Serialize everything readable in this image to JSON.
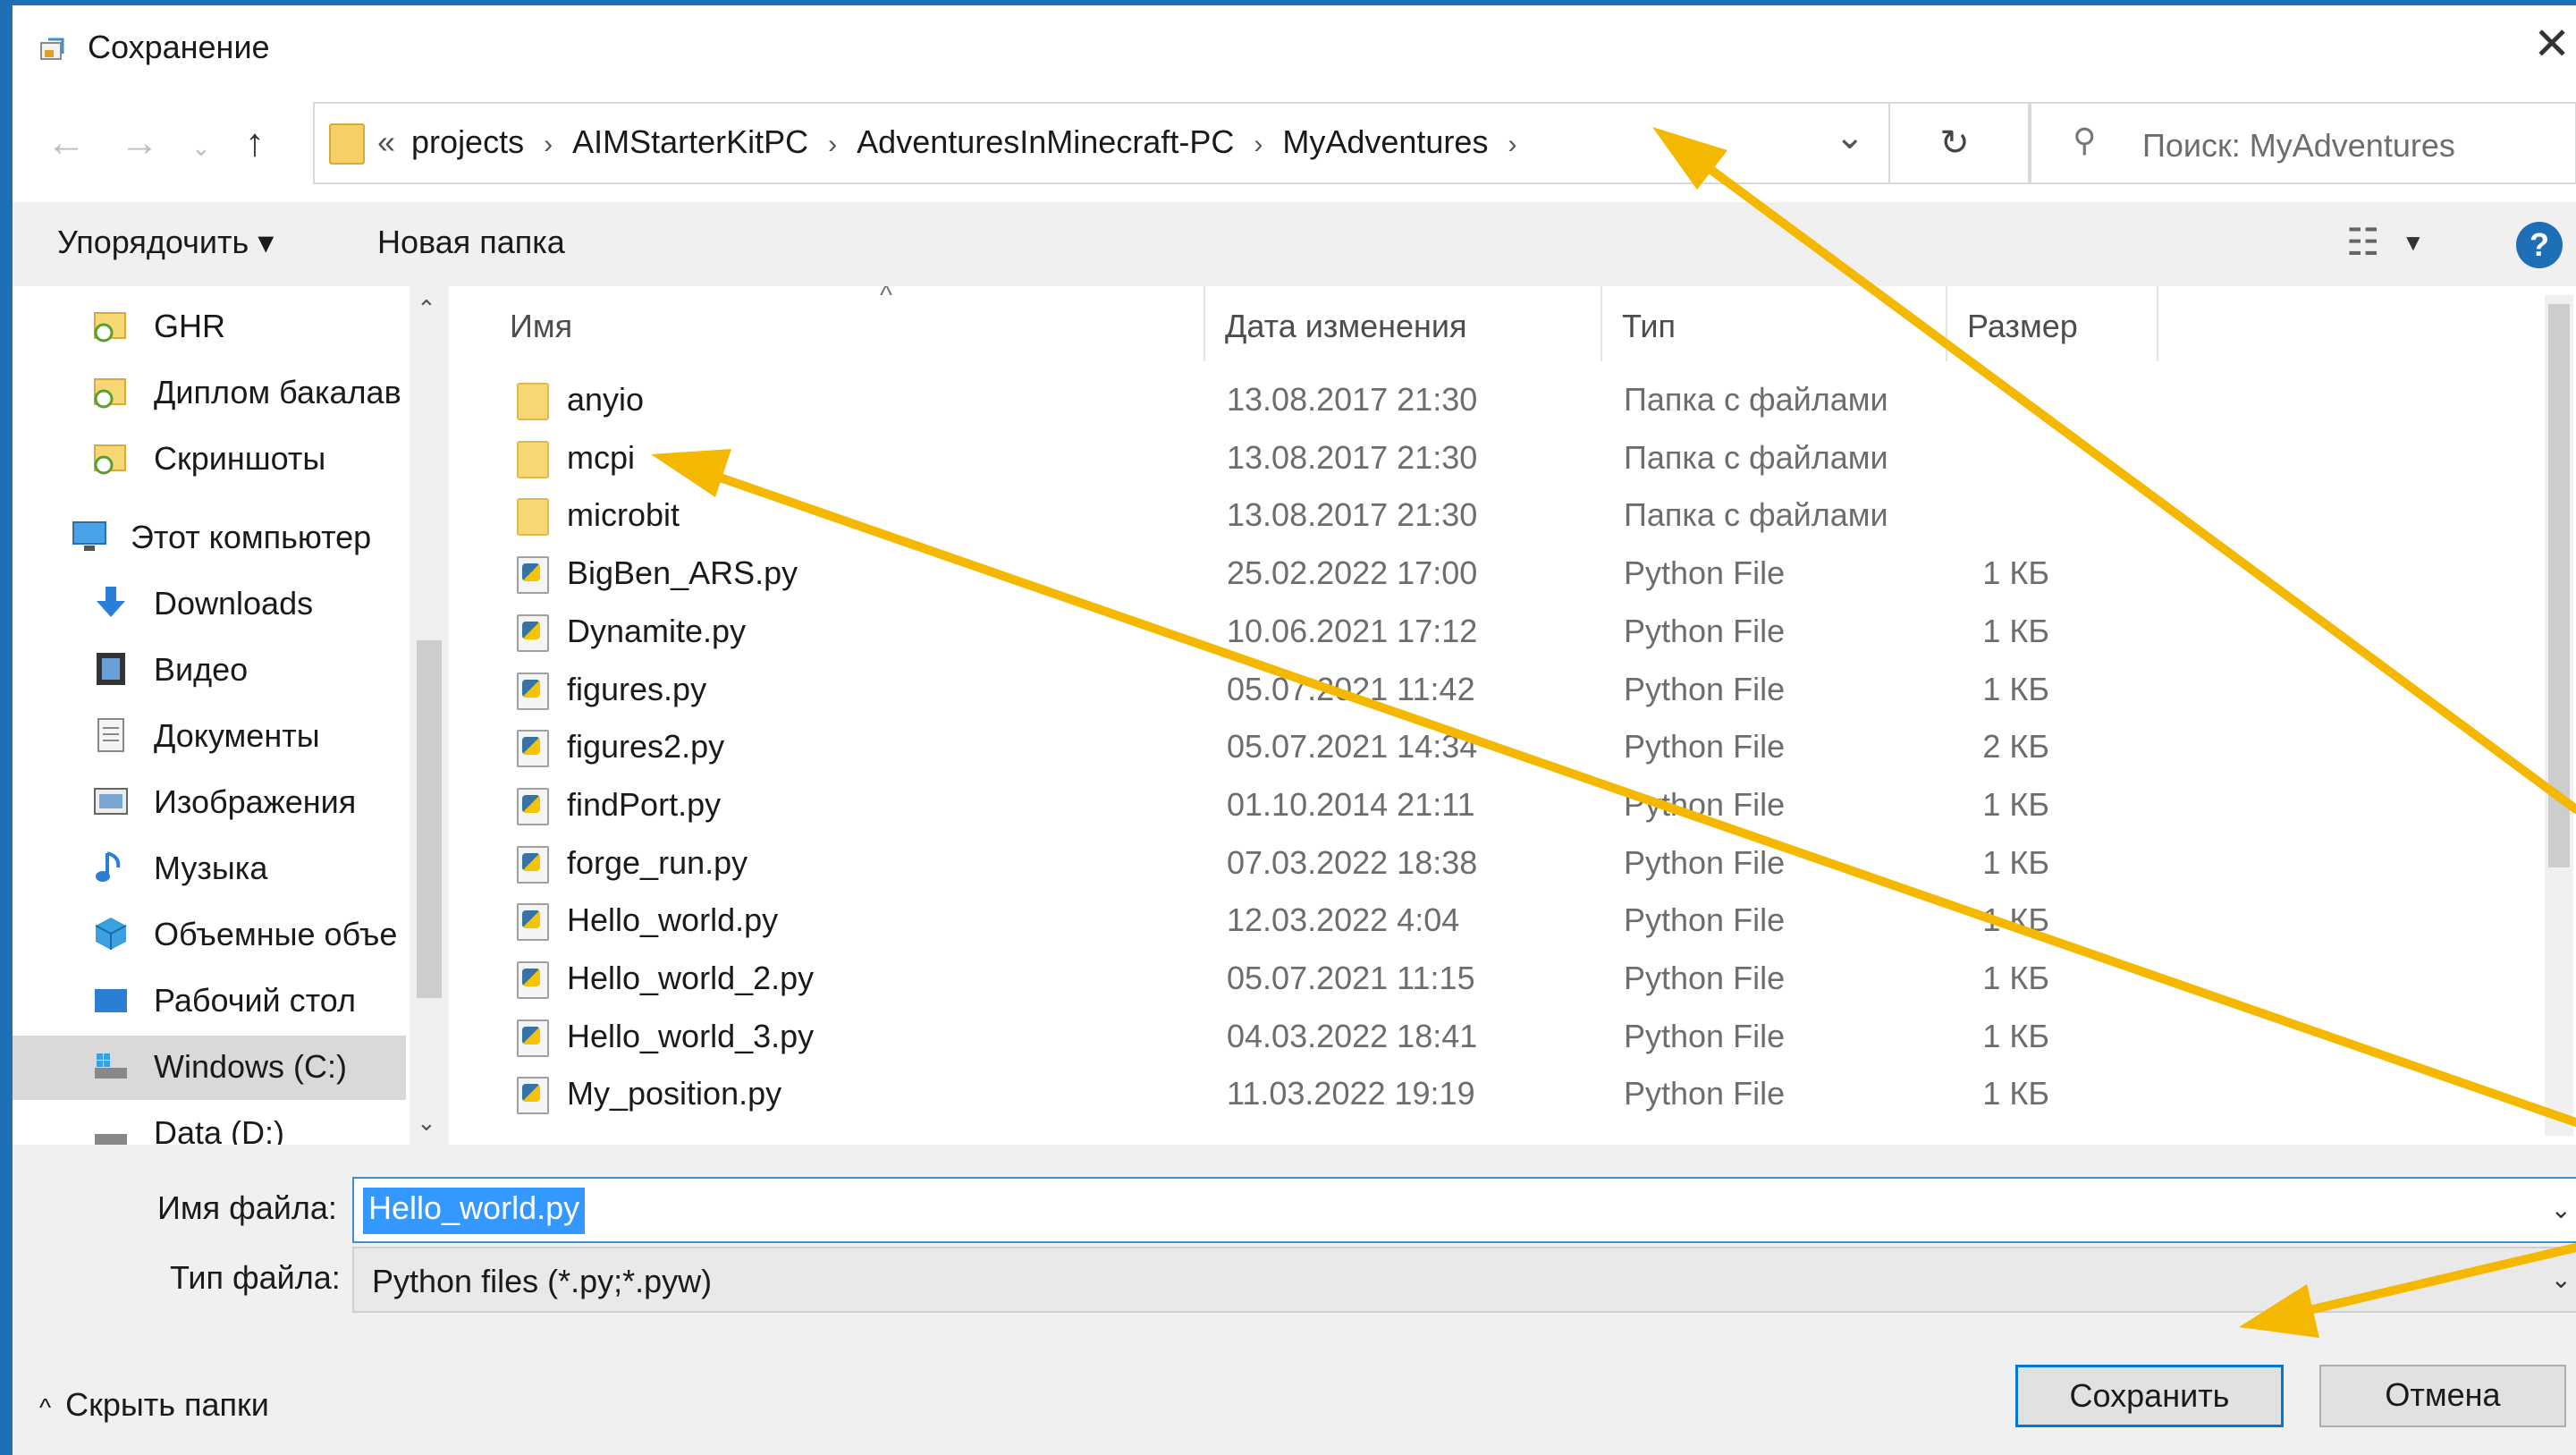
{
  "window": {
    "title": "Сохранение"
  },
  "address": {
    "overflow": "«",
    "crumbs": [
      "projects",
      "AIMStarterKitPC",
      "AdventuresInMinecraft-PC",
      "MyAdventures"
    ],
    "search_placeholder": "Поиск: MyAdventures"
  },
  "toolbar": {
    "organize": "Упорядочить ▾",
    "new_folder": "Новая папка",
    "help": "?"
  },
  "nav": {
    "items": [
      {
        "label": "GHR",
        "icon": "folder-sync-icon"
      },
      {
        "label": "Диплом бакалав",
        "icon": "folder-sync-icon"
      },
      {
        "label": "Скриншоты",
        "icon": "folder-sync-icon"
      },
      {
        "label": "Этот компьютер",
        "icon": "computer-icon"
      },
      {
        "label": "Downloads",
        "icon": "download-icon"
      },
      {
        "label": "Видео",
        "icon": "video-icon"
      },
      {
        "label": "Документы",
        "icon": "documents-icon"
      },
      {
        "label": "Изображения",
        "icon": "pictures-icon"
      },
      {
        "label": "Музыка",
        "icon": "music-icon"
      },
      {
        "label": "Объемные объе",
        "icon": "3d-objects-icon"
      },
      {
        "label": "Рабочий стол",
        "icon": "desktop-icon"
      },
      {
        "label": "Windows (C:)",
        "icon": "drive-icon"
      },
      {
        "label": "Data (D:)",
        "icon": "drive-icon"
      }
    ]
  },
  "columns": {
    "name": "Имя",
    "date": "Дата изменения",
    "type": "Тип",
    "size": "Размер"
  },
  "files": [
    {
      "name": "anyio",
      "date": "13.08.2017 21:30",
      "type": "Папка с файлами",
      "size": "",
      "kind": "folder"
    },
    {
      "name": "mcpi",
      "date": "13.08.2017 21:30",
      "type": "Папка с файлами",
      "size": "",
      "kind": "folder"
    },
    {
      "name": "microbit",
      "date": "13.08.2017 21:30",
      "type": "Папка с файлами",
      "size": "",
      "kind": "folder"
    },
    {
      "name": "BigBen_ARS.py",
      "date": "25.02.2022 17:00",
      "type": "Python File",
      "size": "1 КБ",
      "kind": "py"
    },
    {
      "name": "Dynamite.py",
      "date": "10.06.2021 17:12",
      "type": "Python File",
      "size": "1 КБ",
      "kind": "py"
    },
    {
      "name": "figures.py",
      "date": "05.07.2021 11:42",
      "type": "Python File",
      "size": "1 КБ",
      "kind": "py"
    },
    {
      "name": "figures2.py",
      "date": "05.07.2021 14:34",
      "type": "Python File",
      "size": "2 КБ",
      "kind": "py"
    },
    {
      "name": "findPort.py",
      "date": "01.10.2014 21:11",
      "type": "Python File",
      "size": "1 КБ",
      "kind": "py"
    },
    {
      "name": "forge_run.py",
      "date": "07.03.2022 18:38",
      "type": "Python File",
      "size": "1 КБ",
      "kind": "py"
    },
    {
      "name": "Hello_world.py",
      "date": "12.03.2022 4:04",
      "type": "Python File",
      "size": "1 КБ",
      "kind": "py"
    },
    {
      "name": "Hello_world_2.py",
      "date": "05.07.2021 11:15",
      "type": "Python File",
      "size": "1 КБ",
      "kind": "py"
    },
    {
      "name": "Hello_world_3.py",
      "date": "04.03.2022 18:41",
      "type": "Python File",
      "size": "1 КБ",
      "kind": "py"
    },
    {
      "name": "My_position.py",
      "date": "11.03.2022 19:19",
      "type": "Python File",
      "size": "1 КБ",
      "kind": "py"
    }
  ],
  "form": {
    "filename_label": "Имя файла:",
    "filename_value": "Hello_world.py",
    "filetype_label": "Тип файла:",
    "filetype_value": "Python files (*.py;*.pyw)"
  },
  "footer": {
    "hide_folders": "Скрыть папки",
    "save": "Сохранить",
    "cancel": "Отмена"
  },
  "colors": {
    "accent": "#0078d7",
    "annotation_arrow": "#f5b800",
    "selection": "#3399ff"
  }
}
